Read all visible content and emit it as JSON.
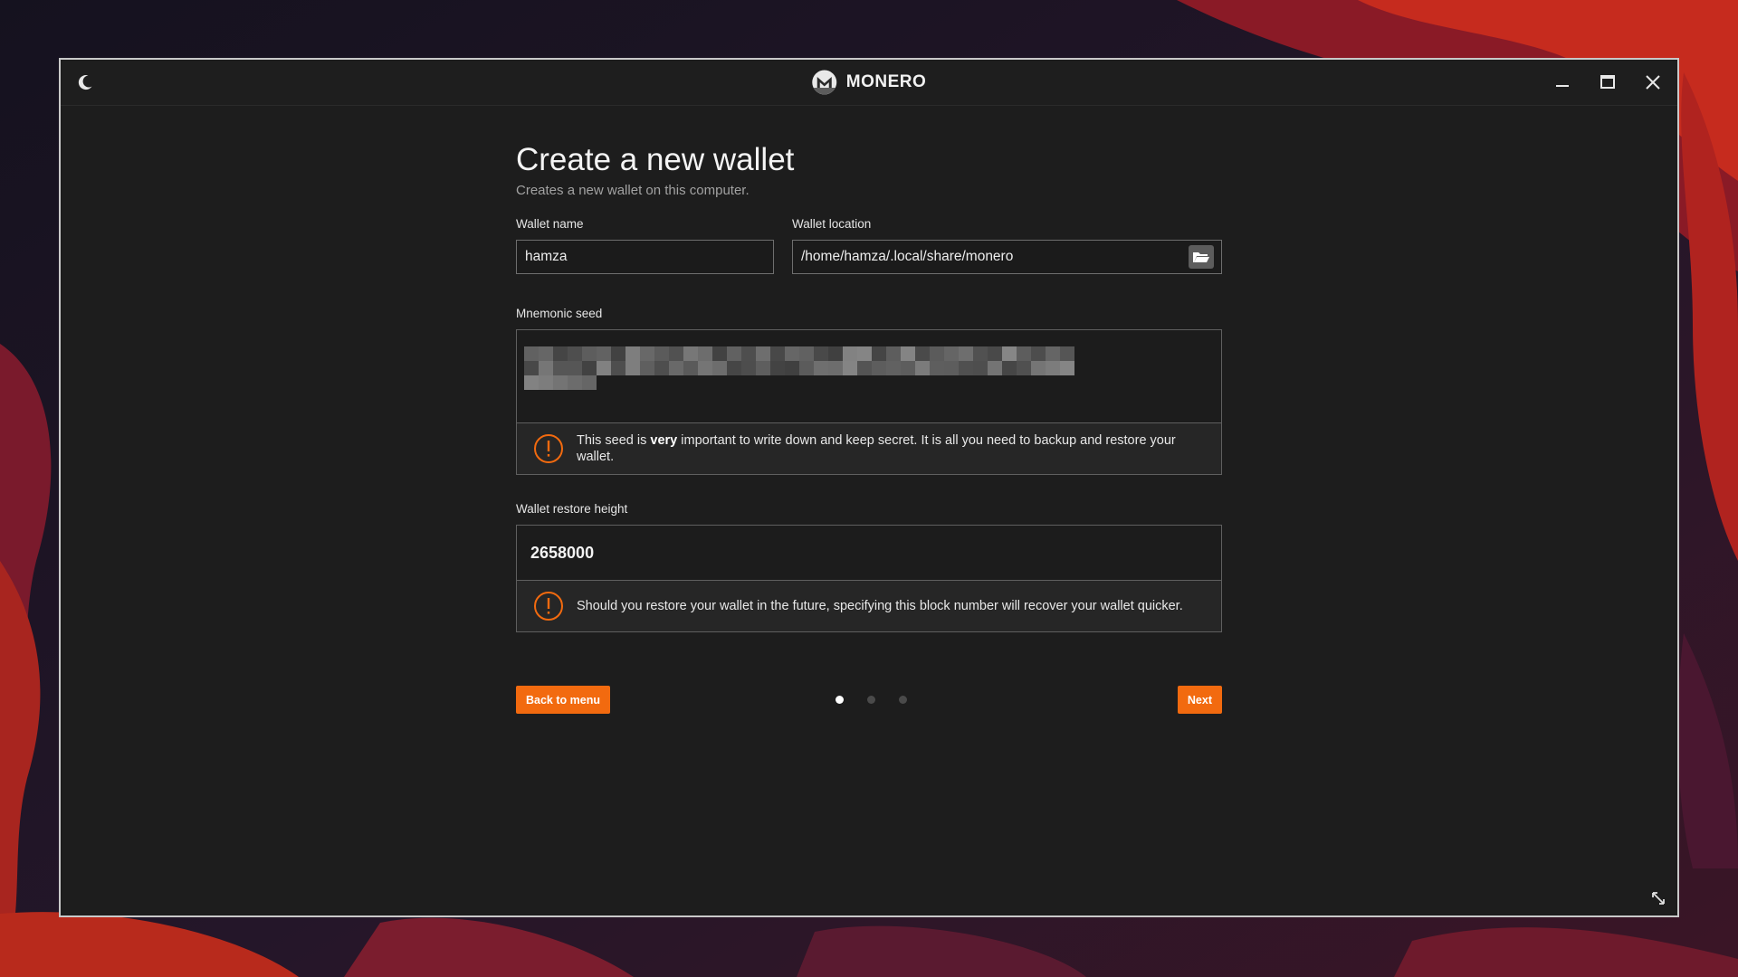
{
  "window": {
    "brand_name": "MONERO",
    "theme_toggle_icon": "moon-icon",
    "controls": [
      "minimize-icon",
      "maximize-icon",
      "close-icon"
    ]
  },
  "page": {
    "title": "Create a new wallet",
    "subtitle": "Creates a new wallet on this computer."
  },
  "wallet_name": {
    "label": "Wallet name",
    "value": "hamza"
  },
  "wallet_location": {
    "label": "Wallet location",
    "value": "/home/hamza/.local/share/monero",
    "browse_icon": "folder-open-icon"
  },
  "mnemonic_seed": {
    "label": "Mnemonic seed",
    "state": "pixelated",
    "warning_before": "This seed is ",
    "warning_bold": "very",
    "warning_after": " important to write down and keep secret. It is all you need to backup and restore your wallet."
  },
  "restore_height": {
    "label": "Wallet restore height",
    "value": "2658000",
    "warning": "Should you restore your wallet in the future, specifying this block number will recover your wallet quicker."
  },
  "navigation": {
    "back_label": "Back to menu",
    "next_label": "Next",
    "step_total": 3,
    "step_current": 1
  },
  "colors": {
    "accent": "#f26a0f",
    "window_bg": "#1d1d1d",
    "warning_icon": "#f26a0f"
  }
}
